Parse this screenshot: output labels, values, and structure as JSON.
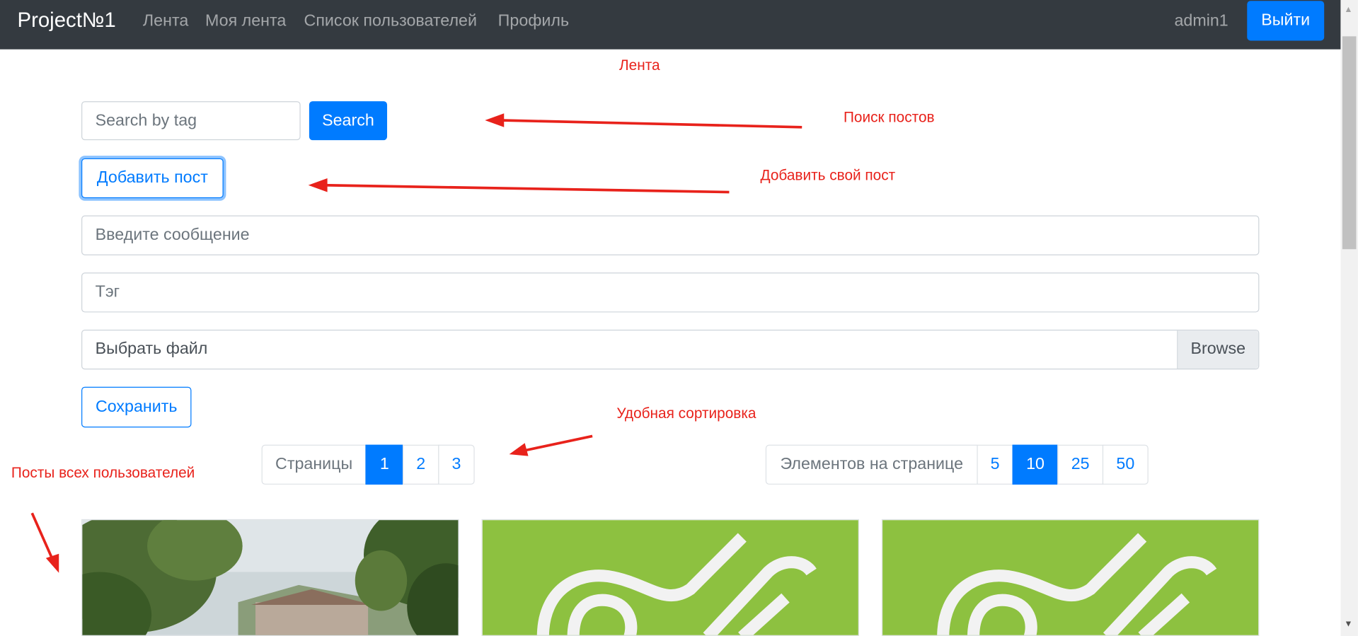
{
  "navbar": {
    "brand": "Project№1",
    "links": [
      "Лента",
      "Моя лента",
      "Список пользователей",
      "Профиль"
    ],
    "user": "admin1",
    "logout": "Выйти"
  },
  "search": {
    "placeholder": "Search by tag",
    "button": "Search"
  },
  "add_post_button": "Добавить пост",
  "form": {
    "message_placeholder": "Введите сообщение",
    "tag_placeholder": "Тэг",
    "file_label": "Выбрать файл",
    "browse": "Browse",
    "save": "Сохранить"
  },
  "pages": {
    "label": "Страницы",
    "items": [
      "1",
      "2",
      "3"
    ],
    "active": "1"
  },
  "page_size": {
    "label": "Элементов на странице",
    "items": [
      "5",
      "10",
      "25",
      "50"
    ],
    "active": "10"
  },
  "annotations": {
    "feed": "Лента",
    "search_posts": "Поиск постов",
    "add_own_post": "Добавить свой пост",
    "sorting": "Удобная сортировка",
    "all_posts": "Посты всех пользователей"
  },
  "colors": {
    "primary": "#007bff",
    "navbar": "#343a40",
    "annotation": "#e8221b",
    "logo_green": "#8dc140"
  }
}
